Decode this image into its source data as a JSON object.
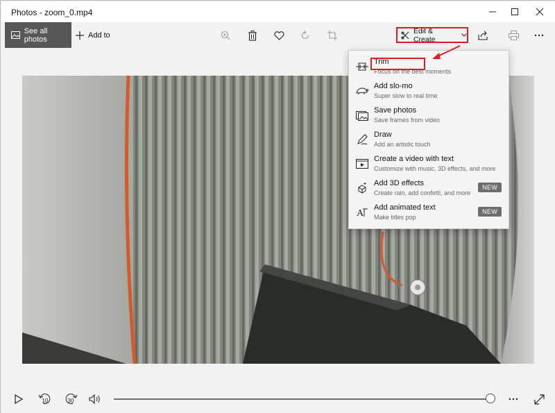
{
  "window": {
    "title": "Photos - zoom_0.mp4"
  },
  "toolbar": {
    "see_all_label": "See all photos",
    "add_to_label": "Add to",
    "edit_create_label": "Edit & Create"
  },
  "menu": {
    "items": [
      {
        "label": "Trim",
        "subtitle": "Focus on the best moments",
        "icon": "trim-icon",
        "badge": ""
      },
      {
        "label": "Add slo-mo",
        "subtitle": "Super slow to real time",
        "icon": "slomo-icon",
        "badge": ""
      },
      {
        "label": "Save photos",
        "subtitle": "Save frames from video",
        "icon": "save-photos-icon",
        "badge": ""
      },
      {
        "label": "Draw",
        "subtitle": "Add an artistic touch",
        "icon": "draw-icon",
        "badge": ""
      },
      {
        "label": "Create a video with text",
        "subtitle": "Customize with music, 3D effects, and more",
        "icon": "video-text-icon",
        "badge": ""
      },
      {
        "label": "Add 3D effects",
        "subtitle": "Create rain, add confetti, and more",
        "icon": "3d-effects-icon",
        "badge": "NEW"
      },
      {
        "label": "Add animated text",
        "subtitle": "Make titles pop",
        "icon": "animated-text-icon",
        "badge": "NEW"
      }
    ]
  },
  "annotations": {
    "highlight_color": "#e01b24"
  },
  "playback": {
    "skip_back_label": "10",
    "skip_forward_label": "30",
    "progress": 1.0
  },
  "colors": {
    "chrome_bg": "#f2f2f2",
    "see_all_bg": "#575757",
    "badge_bg": "#6d6d6d"
  }
}
